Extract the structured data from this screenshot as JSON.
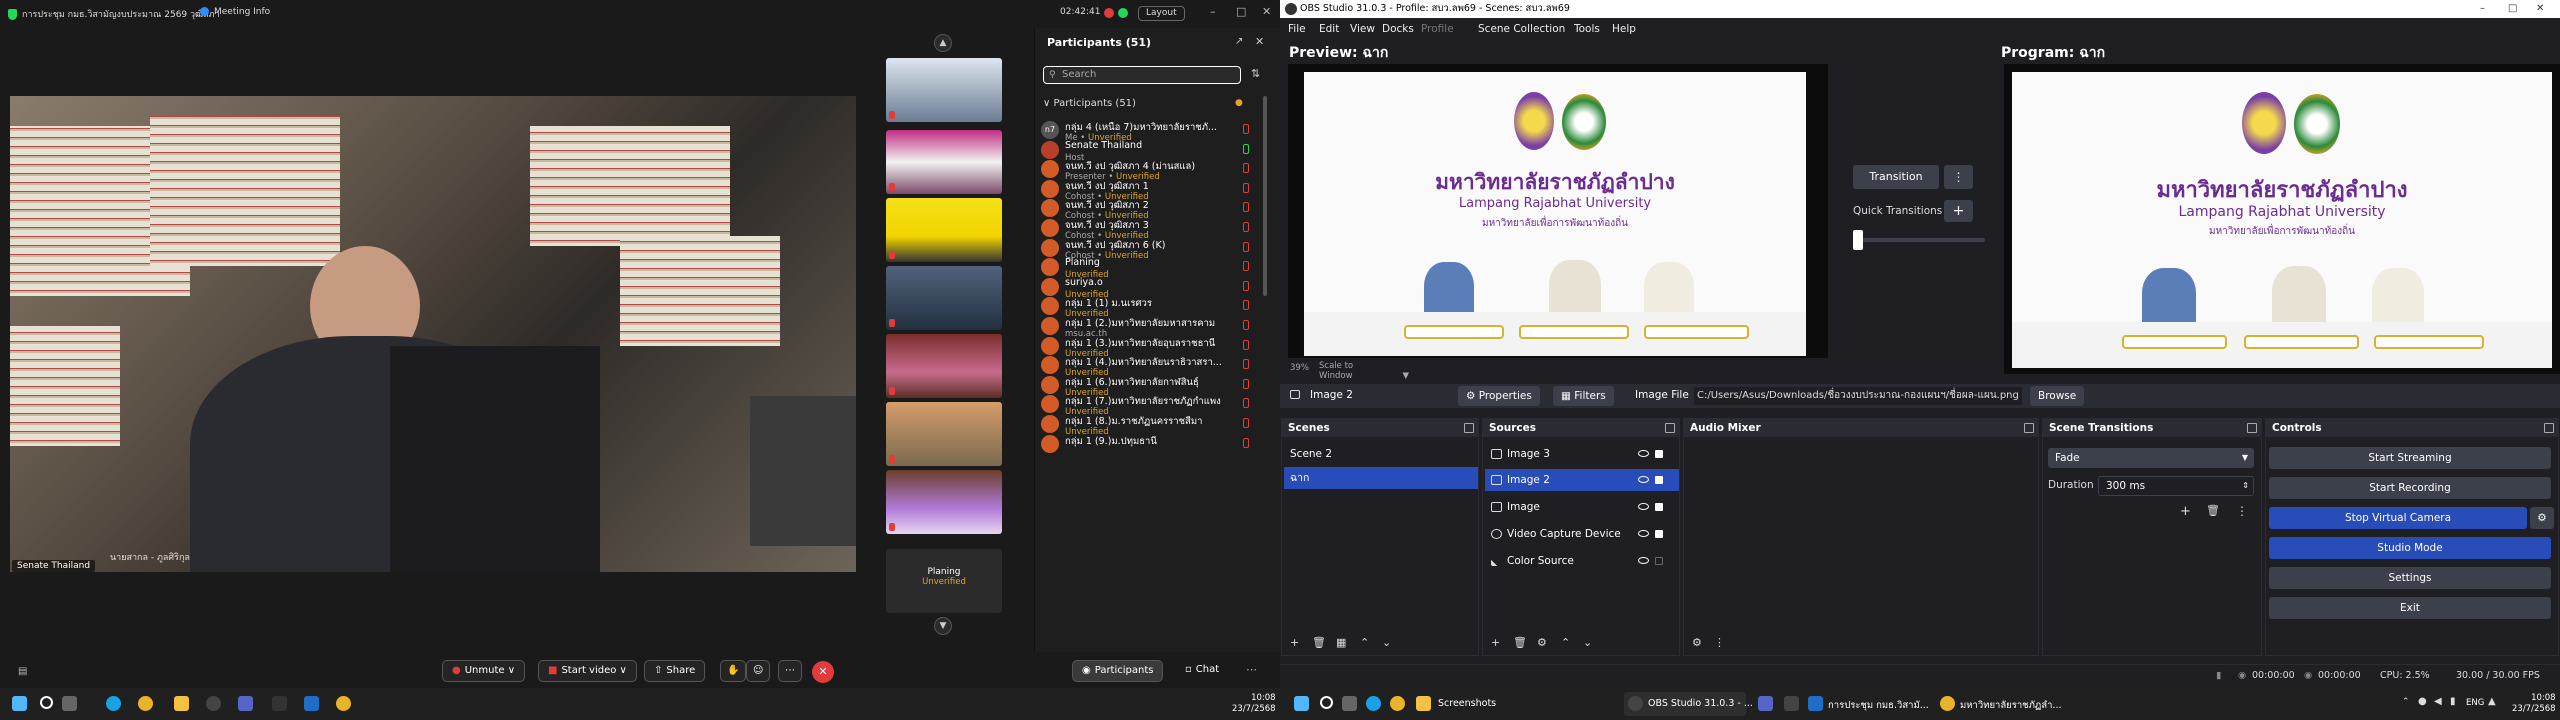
{
  "zoom": {
    "meeting_title": "การประชุม กมธ.วิสามัญงบประมาณ 2569 วุฒิสภา",
    "meeting_info": "Meeting Info",
    "timer": "02:42:41",
    "layout_label": "Layout",
    "speaker_name": "Senate Thailand",
    "speaker_caption": "นายสากล - ภูลศิริกุล",
    "thumb_planing_name": "Planing",
    "thumb_planing_status": "Unverified",
    "participants": {
      "title": "Participants (51)",
      "search_placeholder": "Search",
      "group_label": "Participants (51)",
      "list": [
        {
          "avatar": "n7",
          "name": "กลุ่ม 4 (เหนือ 7)มหาวิทยาลัยราชภั...",
          "role": "Me",
          "unverified": "Unverified"
        },
        {
          "avatar": "",
          "name": "Senate Thailand",
          "role": "Host",
          "unverified": ""
        },
        {
          "avatar": "",
          "name": "จนท.วี งป วุฒิสภา 4 (ม่านสแล)",
          "role": "Presenter",
          "unverified": "Unverified"
        },
        {
          "avatar": "",
          "name": "จนท.วี งป วุฒิสภา 1",
          "role": "Cohost",
          "unverified": "Unverified"
        },
        {
          "avatar": "",
          "name": "จนท.วี งป วุฒิสภา 2",
          "role": "Cohost",
          "unverified": "Unverified"
        },
        {
          "avatar": "",
          "name": "จนท.วี งป วุฒิสภา 3",
          "role": "Cohost",
          "unverified": "Unverified"
        },
        {
          "avatar": "",
          "name": "จนท.วี งป วุฒิสภา 6 (K)",
          "role": "Cohost",
          "unverified": "Unverified"
        },
        {
          "avatar": "",
          "name": "Planing",
          "role": "",
          "unverified": "Unverified"
        },
        {
          "avatar": "",
          "name": "suriya.o",
          "role": "",
          "unverified": "Unverified"
        },
        {
          "avatar": "",
          "name": "กลุ่ม 1 (1) ม.นเรศวร",
          "role": "",
          "unverified": "Unverified"
        },
        {
          "avatar": "",
          "name": "กลุ่ม 1 (2.)มหาวิทยาลัยมหาสารคาม",
          "role": "msu.ac.th",
          "unverified": ""
        },
        {
          "avatar": "",
          "name": "กลุ่ม 1 (3.)มหาวิทยาลัยอุบลราชธานี",
          "role": "",
          "unverified": "Unverified"
        },
        {
          "avatar": "",
          "name": "กลุ่ม 1 (4.)มหาวิทยาลัยนราธิวาสรา...",
          "role": "",
          "unverified": "Unverified"
        },
        {
          "avatar": "",
          "name": "กลุ่ม 1 (6.)มหาวิทยาลัยกาฬสินธุ์",
          "role": "",
          "unverified": "Unverified"
        },
        {
          "avatar": "",
          "name": "กลุ่ม 1 (7.)มหาวิทยาลัยราชภัฏกำแพง",
          "role": "",
          "unverified": "Unverified"
        },
        {
          "avatar": "",
          "name": "กลุ่ม 1 (8.)ม.ราชภัฏนครราชสีมา",
          "role": "",
          "unverified": "Unverified"
        },
        {
          "avatar": "",
          "name": "กลุ่ม 1 (9.)ม.ปทุมธานี",
          "role": "",
          "unverified": ""
        }
      ]
    },
    "bottom": {
      "unmute": "Unmute",
      "start_video": "Start video",
      "share": "Share",
      "participants": "Participants",
      "chat": "Chat"
    }
  },
  "taskbar_left": {
    "time": "10:08",
    "date": "23/7/2568"
  },
  "obs": {
    "title": "OBS Studio 31.0.3 - Profile: สบว.ลพ69 - Scenes: สบว.ลพ69",
    "menu": [
      "File",
      "Edit",
      "View",
      "Docks",
      "Profile",
      "Scene Collection",
      "Tools",
      "Help"
    ],
    "preview_label": "Preview: ฉาก",
    "program_label": "Program: ฉาก",
    "transition_label": "Transition",
    "quick_transitions": "Quick Transitions",
    "zoom_pct": "39%",
    "scale_label": "Scale to Window",
    "frame": {
      "uni_th": "มหาวิทยาลัยราชภัฏลำปาง",
      "uni_en": "Lampang Rajabhat University",
      "uni_sub": "มหาวิทยาลัยเพื่อการพัฒนาท้องถิ่น"
    },
    "source_toolbar": {
      "selected": "Image 2",
      "properties": "Properties",
      "filters": "Filters",
      "image_file_label": "Image File",
      "image_file_path": "C:/Users/Asus/Downloads/ชื่อวงงบประมาณ-กองแผนฯ/ชื่อผล-แผน.png",
      "browse": "Browse"
    },
    "docks": {
      "scenes": "Scenes",
      "sources": "Sources",
      "audio_mixer": "Audio Mixer",
      "scene_transitions": "Scene Transitions",
      "controls": "Controls"
    },
    "scenes": [
      "Scene 2",
      "ฉาก"
    ],
    "sources": [
      "Image 3",
      "Image 2",
      "Image",
      "Video Capture Device",
      "Color Source"
    ],
    "transition_type": "Fade",
    "duration_label": "Duration",
    "duration_value": "300 ms",
    "controls": [
      "Start Streaming",
      "Start Recording",
      "Stop Virtual Camera",
      "Studio Mode",
      "Settings",
      "Exit"
    ],
    "status": {
      "stream_time": "00:00:00",
      "rec_time": "00:00:00",
      "cpu": "CPU: 2.5%",
      "fps": "30.00 / 30.00 FPS"
    }
  },
  "taskbar_right": {
    "screenshots": "Screenshots",
    "obs": "OBS Studio 31.0.3 - ...",
    "zoom_meeting": "การประชุม กมธ.วิสามั...",
    "chrome": "มหาวิทยาลัยราชภัฏลำ...",
    "lang": "ENG",
    "time": "10:08",
    "date": "23/7/2568"
  }
}
